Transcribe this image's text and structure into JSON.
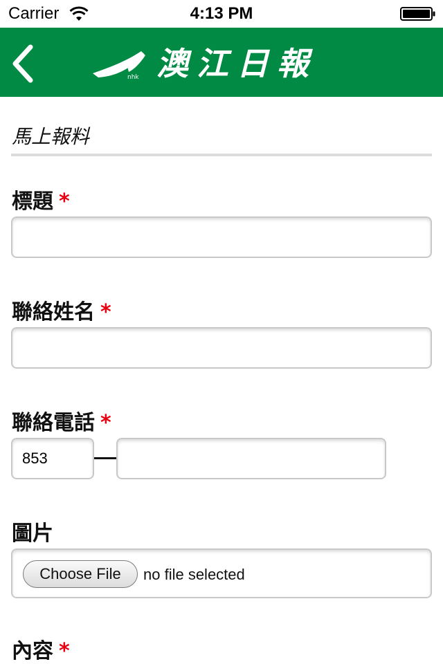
{
  "status_bar": {
    "carrier": "Carrier",
    "time": "4:13 PM"
  },
  "nav": {
    "back_icon": "chevron-left-icon",
    "logo_text": "澳江日報",
    "logo_tag": "nhk"
  },
  "section_title": "馬上報料",
  "required_mark": "*",
  "form": {
    "title_label": "標題",
    "title_value": "",
    "name_label": "聯絡姓名",
    "name_value": "",
    "phone_label": "聯絡電話",
    "phone_area_code": "853",
    "phone_number": "",
    "image_label": "圖片",
    "choose_file_label": "Choose File",
    "file_status": "no file selected",
    "content_label": "內容"
  },
  "colors": {
    "nav_green": "#008a43",
    "required_red": "#e60012"
  }
}
